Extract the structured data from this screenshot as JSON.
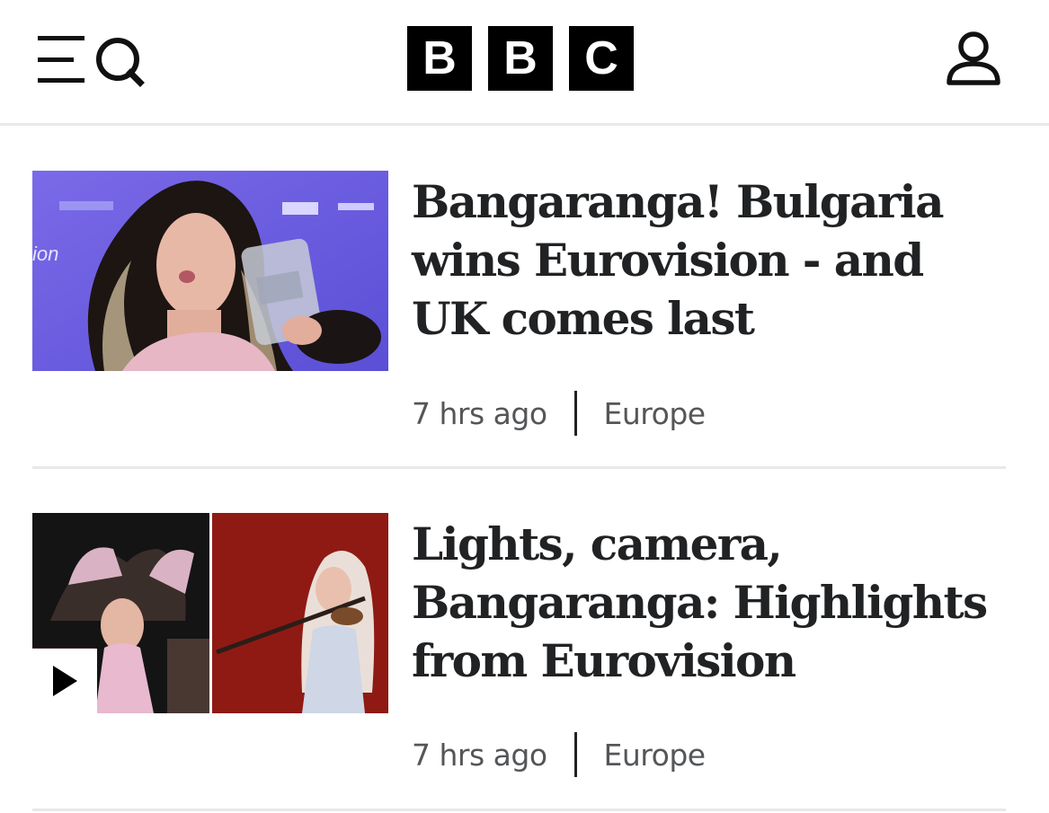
{
  "header": {
    "menu_icon": "menu-search-icon",
    "logo_letters": [
      "B",
      "B",
      "C"
    ],
    "account_icon": "account-icon"
  },
  "articles": [
    {
      "headline": "Bangaranga! Bulgaria wins Eurovision - and UK comes last",
      "time": "7 hrs ago",
      "section": "Europe",
      "image": "singer-holding-eurovision-trophy",
      "has_video": false
    },
    {
      "headline": "Lights, camera, Bangaranga: Highlights from Eurovision",
      "time": "7 hrs ago",
      "section": "Europe",
      "image": "eurovision-performers-collage",
      "has_video": true,
      "video_icon": "play-icon"
    }
  ],
  "colors": {
    "text": "#202224",
    "meta_text": "#545658",
    "divider": "#e6e8ea",
    "logo_bg": "#000000",
    "logo_text": "#ffffff"
  }
}
